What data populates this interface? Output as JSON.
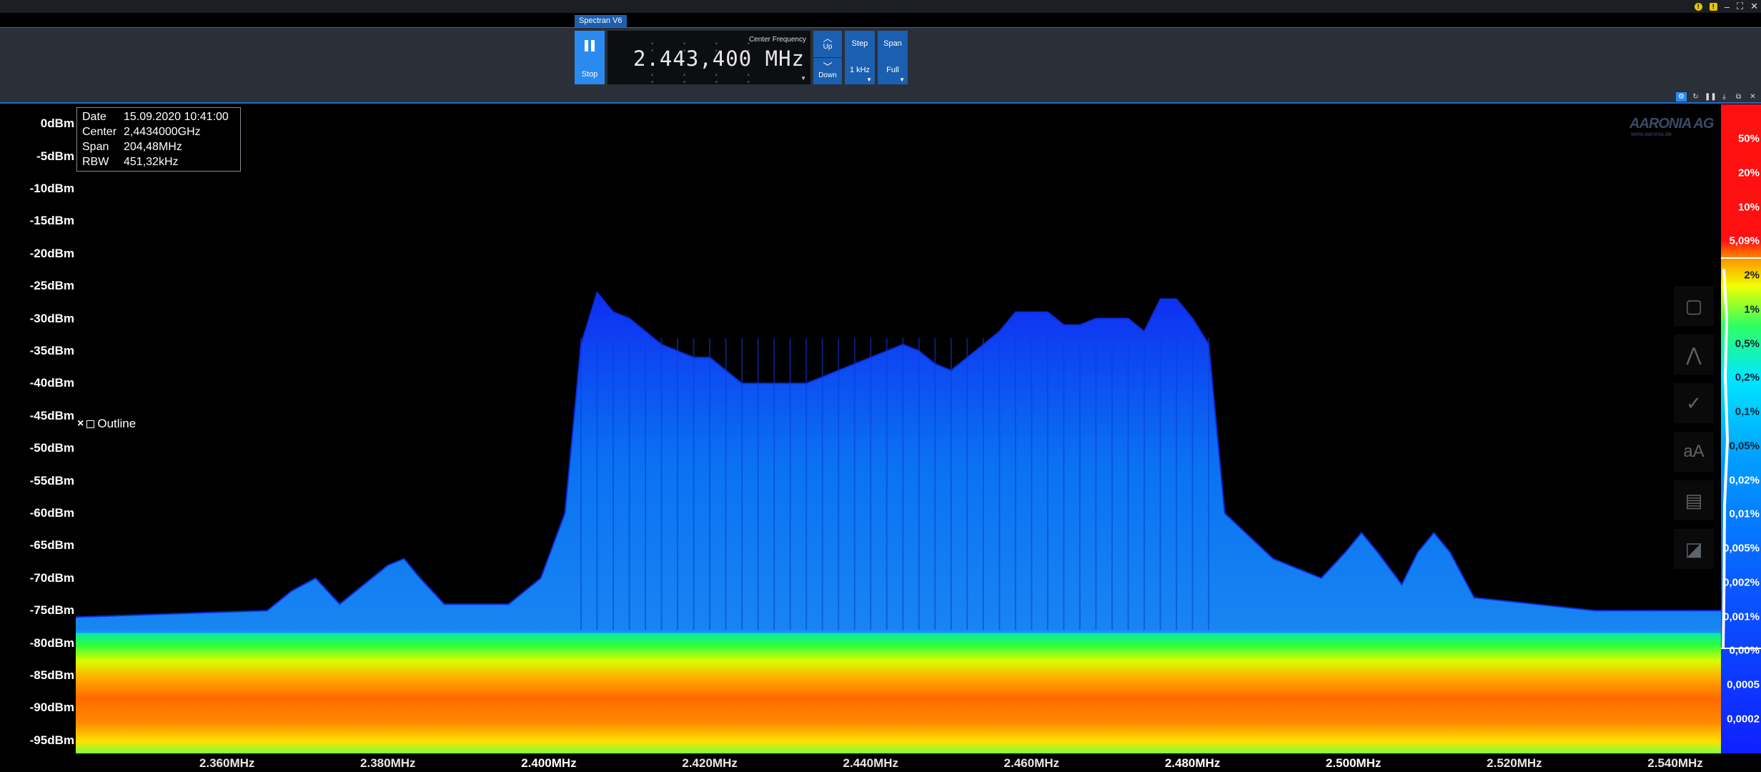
{
  "window": {
    "controls": [
      "–",
      "⛶",
      "✕"
    ],
    "tab_label": "Spectran V6"
  },
  "toolbar": {
    "stop_label": "Stop",
    "freq_caption": "Center Frequency",
    "freq_value": "2.443,400 MHz",
    "up_label": "Up",
    "down_label": "Down",
    "step_label": "Step",
    "step_value": "1 kHz",
    "span_label": "Span",
    "span_value": "Full"
  },
  "info": {
    "date_key": "Date",
    "date_val": "15.09.2020 10:41:00",
    "center_key": "Center",
    "center_val": "2,4434000GHz",
    "span_key": "Span",
    "span_val": "204,48MHz",
    "rbw_key": "RBW",
    "rbw_val": "451,32kHz"
  },
  "outline": {
    "label": "Outline"
  },
  "logo": {
    "name": "AARONIA AG",
    "url": "www.aaronia.de"
  },
  "chart_data": {
    "type": "area",
    "title": "",
    "y_unit": "dBm",
    "ylim": [
      -97,
      3
    ],
    "xlim_mhz": [
      2341.2,
      2545.68
    ],
    "y_ticks": [
      "0dBm",
      "-5dBm",
      "-10dBm",
      "-15dBm",
      "-20dBm",
      "-25dBm",
      "-30dBm",
      "-35dBm",
      "-40dBm",
      "-45dBm",
      "-50dBm",
      "-55dBm",
      "-60dBm",
      "-65dBm",
      "-70dBm",
      "-75dBm",
      "-80dBm",
      "-85dBm",
      "-90dBm",
      "-95dBm"
    ],
    "y_tick_values": [
      0,
      -5,
      -10,
      -15,
      -20,
      -25,
      -30,
      -35,
      -40,
      -45,
      -50,
      -55,
      -60,
      -65,
      -70,
      -75,
      -80,
      -85,
      -90,
      -95
    ],
    "x_ticks": [
      "2.360MHz",
      "2.380MHz",
      "2.400MHz",
      "2.420MHz",
      "2.440MHz",
      "2.460MHz",
      "2.480MHz",
      "2.500MHz",
      "2.520MHz",
      "2.540MHz"
    ],
    "x_tick_values": [
      2360,
      2380,
      2400,
      2420,
      2440,
      2460,
      2480,
      2500,
      2520,
      2540
    ],
    "x_tick_bold": [
      false,
      false,
      true,
      false,
      false,
      false,
      true,
      true,
      false,
      false
    ],
    "peak_outline": [
      [
        2341.2,
        -76
      ],
      [
        2365,
        -75
      ],
      [
        2368,
        -72
      ],
      [
        2371,
        -70
      ],
      [
        2374,
        -74
      ],
      [
        2378,
        -70
      ],
      [
        2380,
        -68
      ],
      [
        2382,
        -67
      ],
      [
        2384,
        -70
      ],
      [
        2387,
        -74
      ],
      [
        2395,
        -74
      ],
      [
        2399,
        -70
      ],
      [
        2402,
        -60
      ],
      [
        2404,
        -34
      ],
      [
        2406,
        -26
      ],
      [
        2408,
        -29
      ],
      [
        2410,
        -30
      ],
      [
        2412,
        -32
      ],
      [
        2414,
        -34
      ],
      [
        2416,
        -35
      ],
      [
        2418,
        -36
      ],
      [
        2420,
        -36
      ],
      [
        2422,
        -38
      ],
      [
        2424,
        -40
      ],
      [
        2426,
        -40
      ],
      [
        2428,
        -40
      ],
      [
        2430,
        -40
      ],
      [
        2432,
        -40
      ],
      [
        2434,
        -39
      ],
      [
        2436,
        -38
      ],
      [
        2438,
        -37
      ],
      [
        2440,
        -36
      ],
      [
        2442,
        -35
      ],
      [
        2444,
        -34
      ],
      [
        2446,
        -35
      ],
      [
        2448,
        -37
      ],
      [
        2450,
        -38
      ],
      [
        2452,
        -36
      ],
      [
        2454,
        -34
      ],
      [
        2456,
        -32
      ],
      [
        2458,
        -29
      ],
      [
        2460,
        -29
      ],
      [
        2462,
        -29
      ],
      [
        2464,
        -31
      ],
      [
        2466,
        -31
      ],
      [
        2468,
        -30
      ],
      [
        2470,
        -30
      ],
      [
        2472,
        -30
      ],
      [
        2474,
        -32
      ],
      [
        2476,
        -27
      ],
      [
        2478,
        -27
      ],
      [
        2480,
        -30
      ],
      [
        2482,
        -34
      ],
      [
        2484,
        -60
      ],
      [
        2490,
        -67
      ],
      [
        2496,
        -70
      ],
      [
        2499,
        -66
      ],
      [
        2501,
        -63
      ],
      [
        2503,
        -66
      ],
      [
        2506,
        -71
      ],
      [
        2508,
        -66
      ],
      [
        2510,
        -63
      ],
      [
        2512,
        -66
      ],
      [
        2515,
        -73
      ],
      [
        2530,
        -75
      ],
      [
        2545.68,
        -75
      ]
    ],
    "noise_floor_dbm": -78,
    "colorbar_labels": [
      "50%",
      "20%",
      "10%",
      "5,09%",
      "2%",
      "1%",
      "0,5%",
      "0,2%",
      "0,1%",
      "0,05%",
      "0,02%",
      "0,01%",
      "0,005%",
      "0,002%",
      "0,001%",
      "0,00%",
      "0,0005",
      "0,0002"
    ]
  }
}
